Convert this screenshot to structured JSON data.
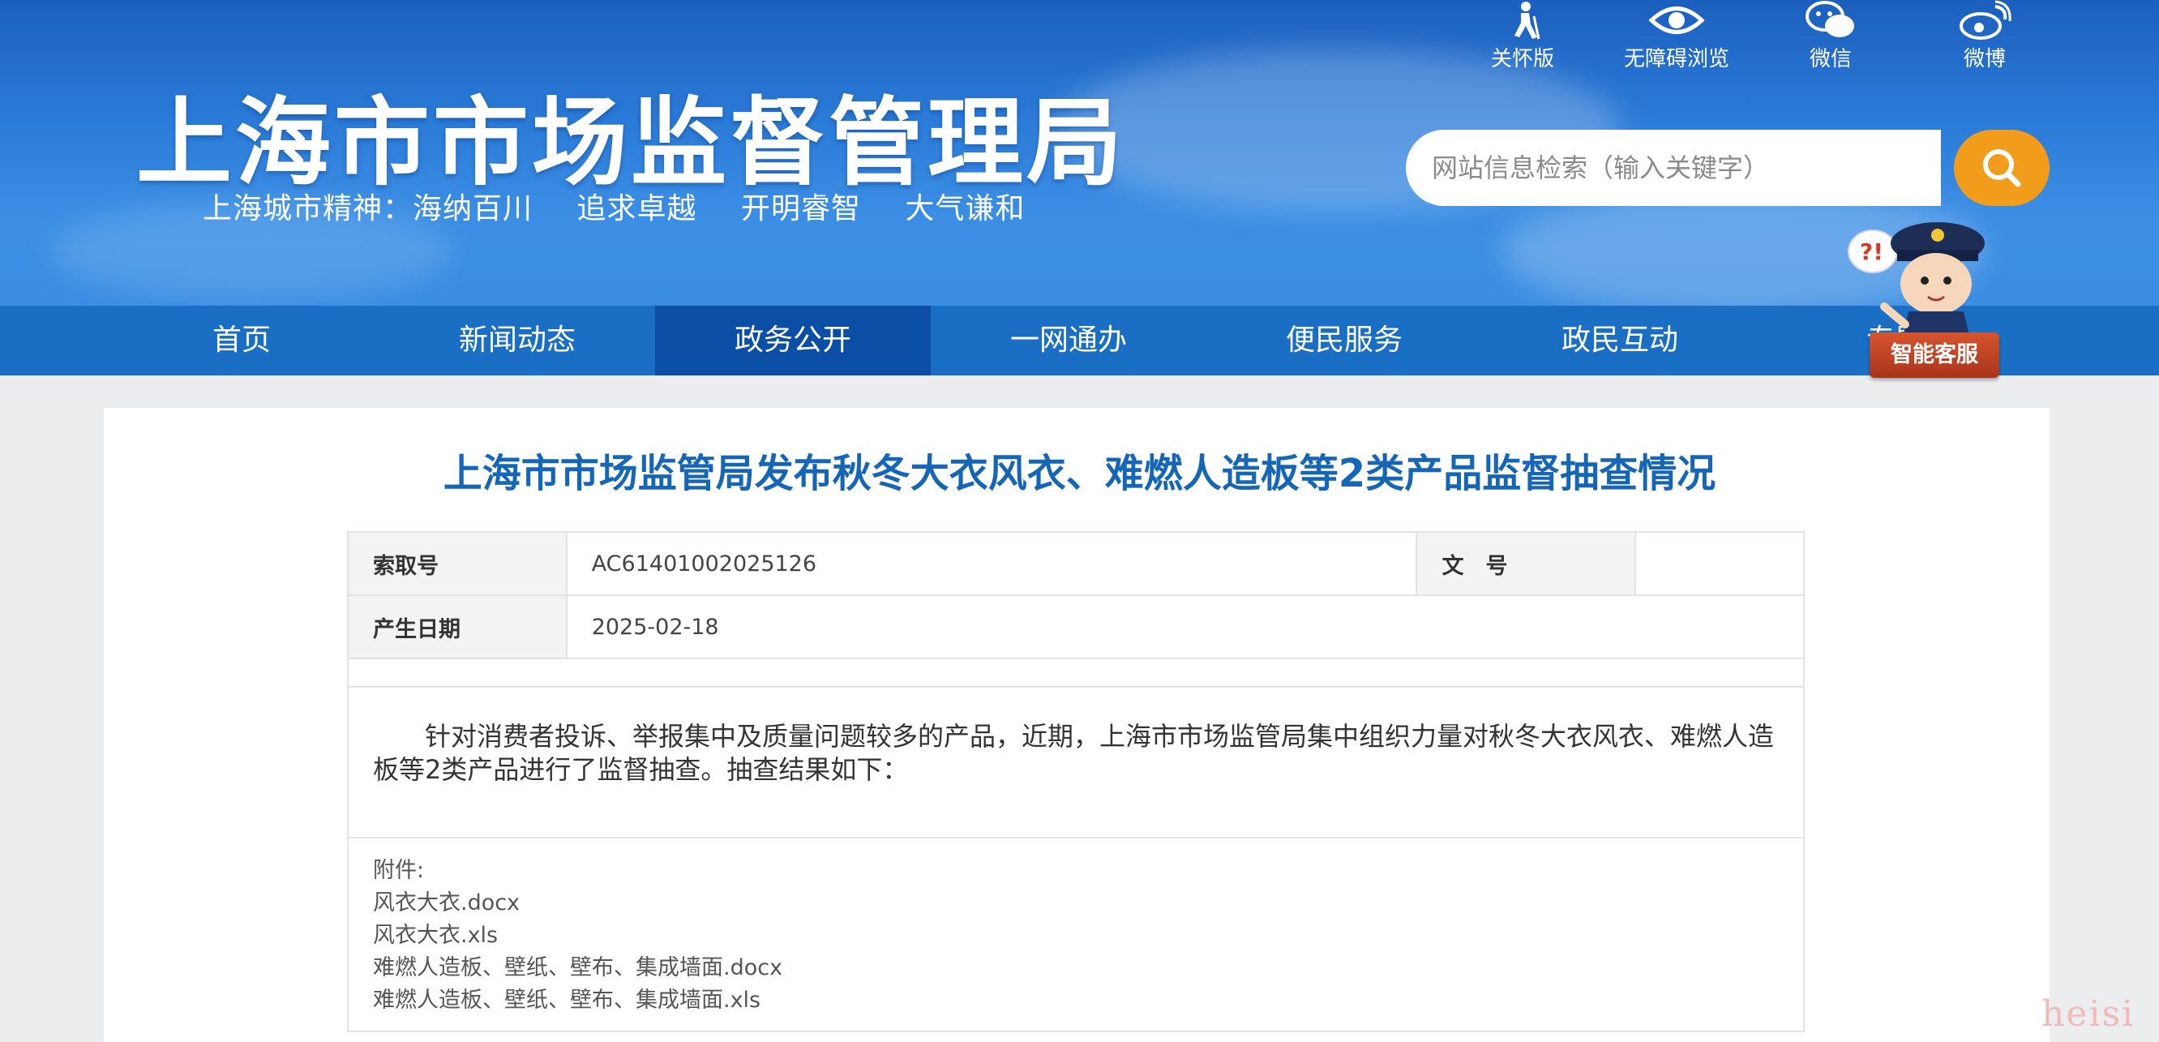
{
  "header": {
    "site_title": "上海市市场监督管理局",
    "slogan": [
      "上海城市精神：海纳百川",
      "追求卓越",
      "开明睿智",
      "大气谦和"
    ],
    "top_links": [
      {
        "label": "关怀版",
        "icon": "elderly-care-icon"
      },
      {
        "label": "无障碍浏览",
        "icon": "eye-icon"
      },
      {
        "label": "微信",
        "icon": "wechat-icon"
      },
      {
        "label": "微博",
        "icon": "weibo-icon"
      }
    ],
    "search": {
      "placeholder": "网站信息检索（输入关键字）",
      "value": "",
      "button_icon": "search-icon"
    }
  },
  "nav": {
    "items": [
      "首页",
      "新闻动态",
      "政务公开",
      "一网通办",
      "便民服务",
      "政民互动",
      "专题"
    ],
    "active_index": 2
  },
  "assistant": {
    "label": "智能客服",
    "icon": "police-mascot-icon"
  },
  "article": {
    "title": "上海市市场监管局发布秋冬大衣风衣、难燃人造板等2类产品监督抽查情况",
    "meta": {
      "index_label": "索取号",
      "index_value": "AC61401002025126",
      "docno_label": "文　号",
      "docno_value": "",
      "date_label": "产生日期",
      "date_value": "2025-02-18"
    },
    "body": "针对消费者投诉、举报集中及质量问题较多的产品，近期，上海市市场监管局集中组织力量对秋冬大衣风衣、难燃人造板等2类产品进行了监督抽查。抽查结果如下：",
    "attachments_label": "附件:",
    "attachments": [
      "风衣大衣.docx",
      "风衣大衣.xls",
      "难燃人造板、壁纸、壁布、集成墙面.docx",
      "难燃人造板、壁纸、壁布、集成墙面.xls"
    ]
  },
  "watermark": "heisi",
  "colors": {
    "header_blue": "#2b7bd8",
    "nav_blue": "#1a6fc5",
    "nav_active": "#0a4ea6",
    "search_orange": "#f29c1b",
    "title_blue": "#1666b7",
    "assistant_red": "#c2441f"
  }
}
